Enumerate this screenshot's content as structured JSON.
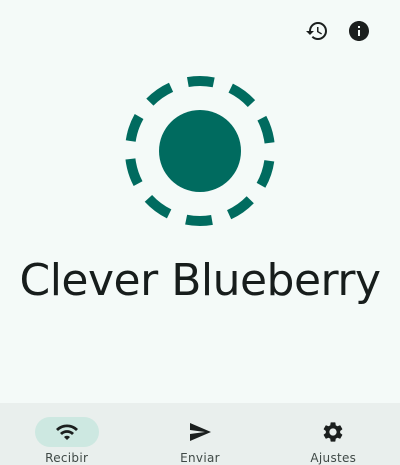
{
  "device": {
    "name": "Clever Blueberry",
    "accent_color": "#006b5f"
  },
  "toolbar": {
    "history_icon": "history-icon",
    "info_icon": "info-icon"
  },
  "nav": {
    "items": [
      {
        "label": "Recibir",
        "icon": "wifi-icon",
        "active": true
      },
      {
        "label": "Enviar",
        "icon": "send-icon",
        "active": false
      },
      {
        "label": "Ajustes",
        "icon": "settings-icon",
        "active": false
      }
    ]
  },
  "colors": {
    "background": "#f4faf8",
    "nav_background": "#e9efed",
    "active_indicator": "#cde8e1",
    "text": "#171d1c"
  }
}
